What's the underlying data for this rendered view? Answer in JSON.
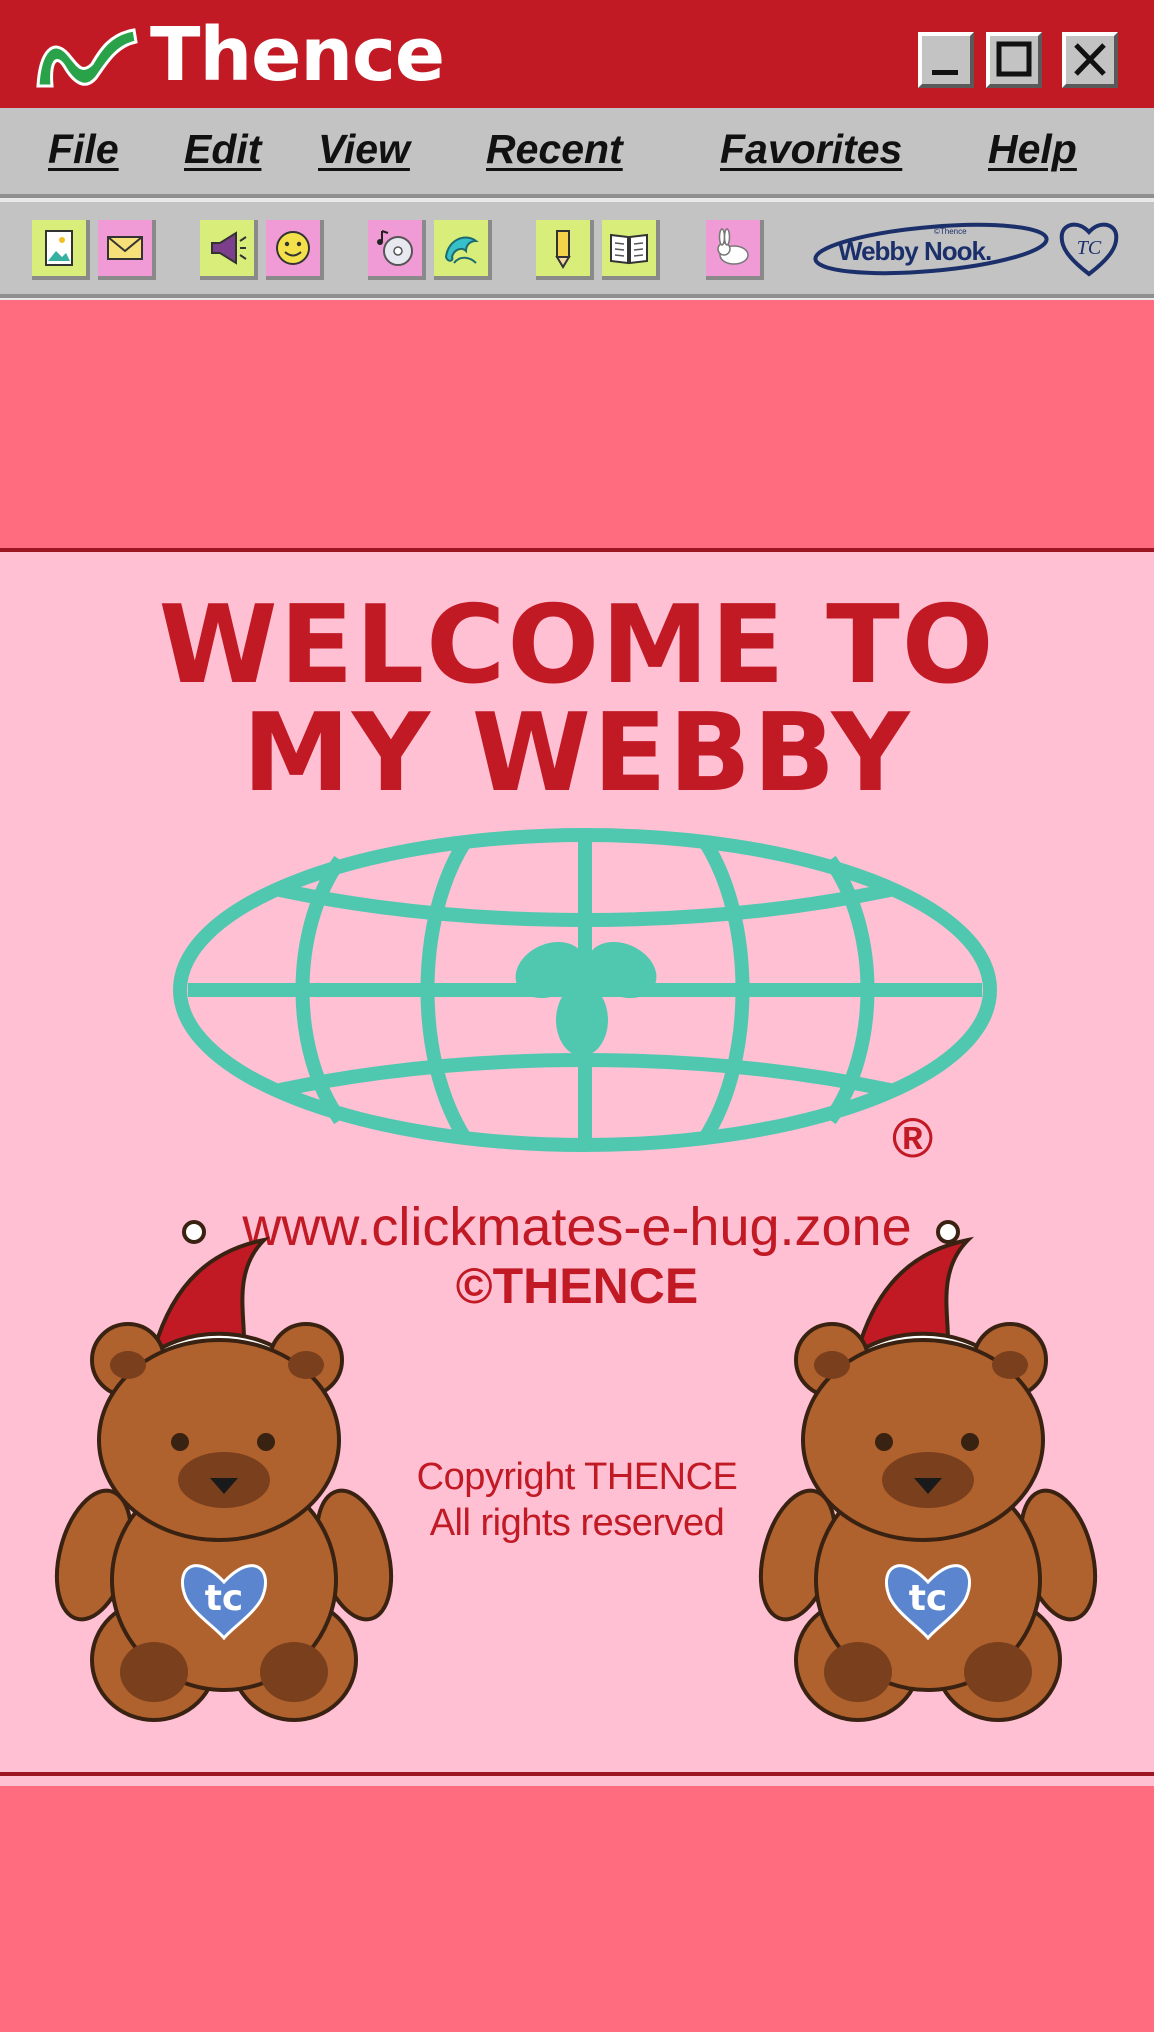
{
  "window": {
    "title": "Thence",
    "logo_icon": "thence-wave-logo-icon",
    "controls": [
      "minimize",
      "maximize",
      "close"
    ]
  },
  "menu": {
    "items": [
      {
        "label": "File"
      },
      {
        "label": "Edit"
      },
      {
        "label": "View"
      },
      {
        "label": "Recent"
      },
      {
        "label": "Favorites"
      },
      {
        "label": "Help"
      }
    ]
  },
  "toolbar": {
    "buttons": [
      {
        "icon": "picture-icon"
      },
      {
        "icon": "envelope-icon"
      },
      {
        "icon": "megaphone-icon"
      },
      {
        "icon": "smiley-icon"
      },
      {
        "icon": "music-cd-icon"
      },
      {
        "icon": "dolphin-icon"
      },
      {
        "icon": "pencil-icon"
      },
      {
        "icon": "open-book-icon"
      },
      {
        "icon": "rabbit-icon"
      }
    ],
    "brand": {
      "small": "©Thence",
      "name": "Webby Nook."
    },
    "badge": "TC"
  },
  "content": {
    "welcome_line1": "WELCOME TO",
    "welcome_line2": "MY WEBBY",
    "registered_mark": "®",
    "url": "www.clickmates-e-hug.zone",
    "copyright_brand": "©THENCE",
    "copyright_line1": "Copyright THENCE",
    "copyright_line2": "All rights reserved",
    "bear_badge": "tc"
  },
  "colors": {
    "title_bar": "#c21a25",
    "chrome_gray": "#c3c3c3",
    "band": "#ff6b7f",
    "page_pink": "#ffc0d3",
    "accent_red": "#c21a25",
    "globe_teal": "#50c8b0",
    "bear_brown": "#b0622e"
  }
}
